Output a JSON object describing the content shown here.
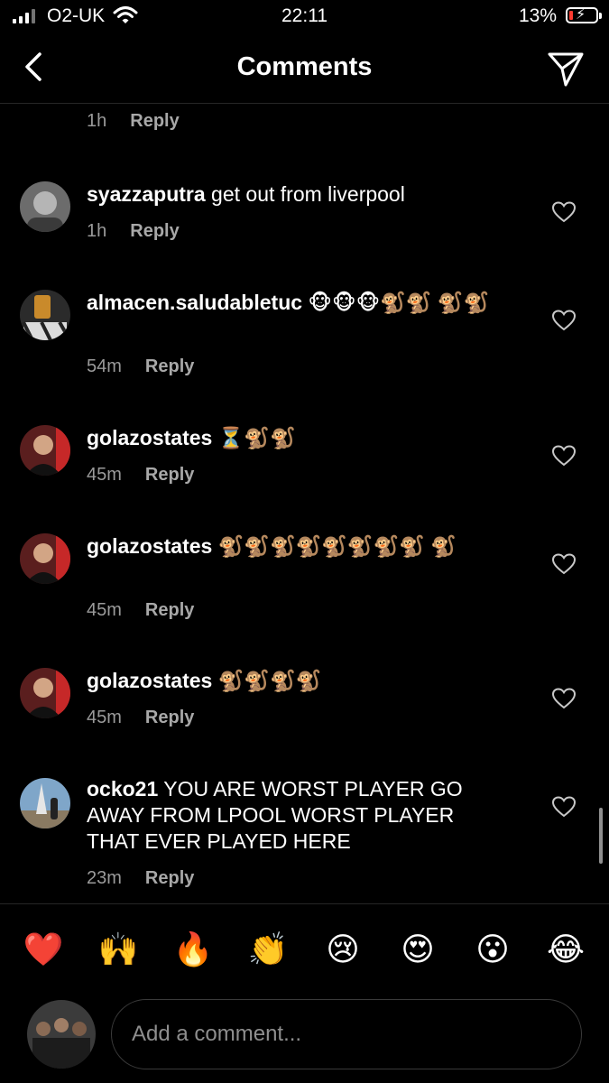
{
  "status_bar": {
    "carrier": "O2-UK",
    "time": "22:11",
    "battery_pct": "13%",
    "battery_level": 0.13,
    "icons": [
      "signal-icon",
      "wifi-icon",
      "battery-charging-icon"
    ]
  },
  "header": {
    "title": "Comments",
    "back_icon": "chevron-left-icon",
    "share_icon": "paper-plane-icon"
  },
  "partial_comment": {
    "time": "1h",
    "reply": "Reply"
  },
  "comments": [
    {
      "username": "syazzaputra",
      "text": " get out from liverpool",
      "time": "1h",
      "reply": "Reply"
    },
    {
      "username": "almacen.saludabletuc",
      "text": " 🐵🐵🐵🐒🐒 🐒🐒",
      "time": "54m",
      "reply": "Reply"
    },
    {
      "username": "golazostates",
      "text": " ⏳🐒🐒",
      "time": "45m",
      "reply": "Reply"
    },
    {
      "username": "golazostates",
      "text": " 🐒🐒🐒🐒🐒🐒🐒🐒 🐒",
      "time": "45m",
      "reply": "Reply"
    },
    {
      "username": "golazostates",
      "text": " 🐒🐒🐒🐒",
      "time": "45m",
      "reply": "Reply"
    },
    {
      "username": "ocko21",
      "text": " YOU ARE WORST PLAYER GO AWAY FROM LPOOL WORST PLAYER THAT EVER PLAYED HERE",
      "time": "23m",
      "reply": "Reply"
    }
  ],
  "emoji_bar": [
    "❤️",
    "🙌",
    "🔥",
    "👏",
    "😢",
    "😍",
    "😮",
    "😂"
  ],
  "composer": {
    "placeholder": "Add a comment..."
  },
  "colors": {
    "background": "#000000",
    "secondary_text": "#9a9a9a",
    "battery_low": "#ff3b30"
  }
}
